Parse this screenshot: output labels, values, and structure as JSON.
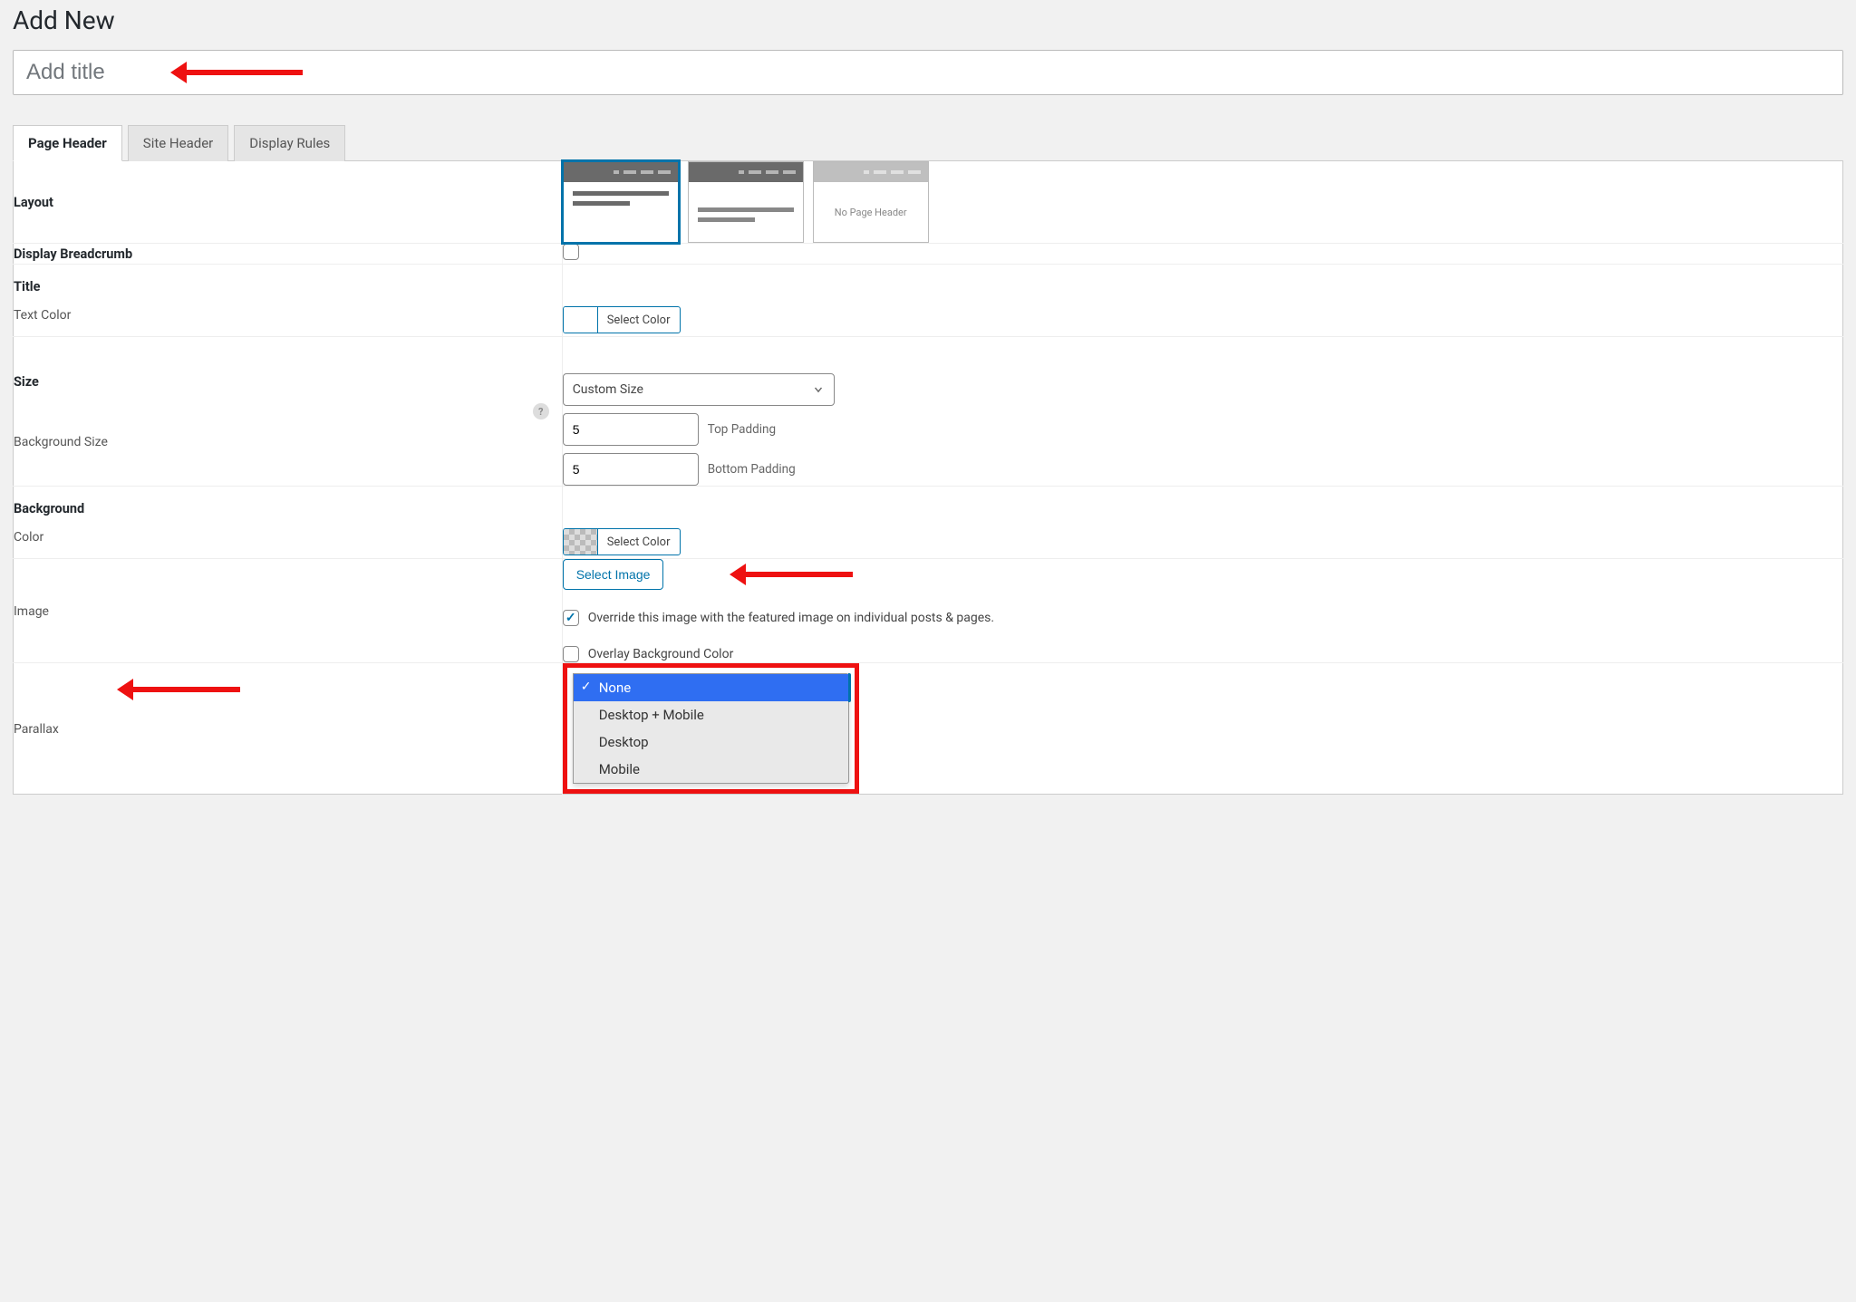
{
  "page": {
    "title": "Add New"
  },
  "title_input": {
    "placeholder": "Add title"
  },
  "tabs": [
    {
      "label": "Page Header",
      "active": true
    },
    {
      "label": "Site Header",
      "active": false
    },
    {
      "label": "Display Rules",
      "active": false
    }
  ],
  "rows": {
    "layout": {
      "label": "Layout",
      "options": [
        "header-with-content",
        "header-only",
        "no-page-header"
      ],
      "no_header_text": "No Page Header"
    },
    "breadcrumb": {
      "label": "Display Breadcrumb",
      "checked": false
    },
    "title": {
      "heading": "Title",
      "text_color_label": "Text Color",
      "select_color": "Select Color"
    },
    "size": {
      "heading": "Size",
      "bg_size_label": "Background Size",
      "select_value": "Custom Size",
      "top_padding_value": "5",
      "top_padding_label": "Top Padding",
      "bottom_padding_value": "5",
      "bottom_padding_label": "Bottom Padding"
    },
    "background": {
      "heading": "Background",
      "color_label": "Color",
      "select_color": "Select Color"
    },
    "image": {
      "label": "Image",
      "button": "Select Image",
      "override_checked": true,
      "override_label": "Override this image with the featured image on individual posts & pages.",
      "overlay_checked": false,
      "overlay_label": "Overlay Background Color"
    },
    "parallax": {
      "label": "Parallax",
      "options": [
        "None",
        "Desktop + Mobile",
        "Desktop",
        "Mobile"
      ],
      "selected": "None"
    }
  }
}
